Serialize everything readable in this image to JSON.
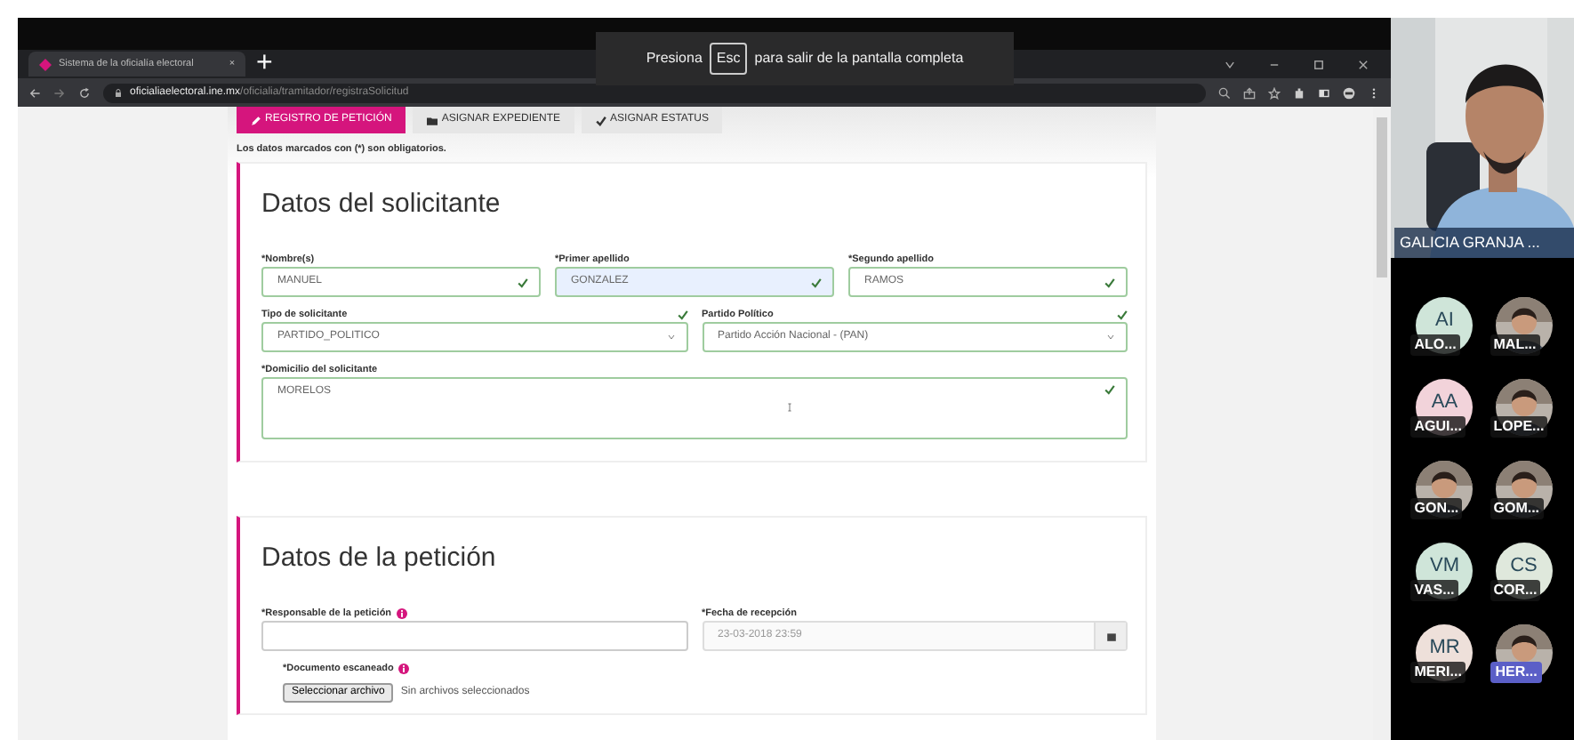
{
  "browser": {
    "tab": {
      "title": "Sistema de la oficialía electoral",
      "close": "×"
    },
    "new_tab": "+",
    "url": {
      "domain": "oficialiaelectoral.ine.mx",
      "path": "/oficialia/tramitador/registraSolicitud"
    }
  },
  "fullscreen_notice": {
    "prefix": "Presiona",
    "key": "Esc",
    "suffix": "para salir de la pantalla completa"
  },
  "tabs": [
    {
      "label": "REGISTRO DE PETICIÓN",
      "selected": true
    },
    {
      "label": "ASIGNAR EXPEDIENTE",
      "selected": false
    },
    {
      "label": "ASIGNAR ESTATUS",
      "selected": false
    }
  ],
  "required_note": "Los datos marcados con (*) son obligatorios.",
  "sections": [
    {
      "title": "Datos del solicitante",
      "rows": [
        [
          {
            "kind": "text",
            "label": "*Nombre(s)",
            "value": "MANUEL",
            "valid": true,
            "highlighted": false
          },
          {
            "kind": "text",
            "label": "*Primer apellido",
            "value": "GONZALEZ",
            "valid": true,
            "highlighted": true
          },
          {
            "kind": "text",
            "label": "*Segundo apellido",
            "value": "RAMOS",
            "valid": true,
            "highlighted": false
          }
        ],
        [
          {
            "kind": "select",
            "label": "Tipo de solicitante",
            "value": "PARTIDO_POLITICO",
            "valid": true,
            "highlighted": false
          },
          {
            "kind": "select",
            "label": "Partido Político",
            "value": "Partido Acción Nacional - (PAN)",
            "valid": true,
            "highlighted": false
          }
        ],
        [
          {
            "kind": "textarea",
            "label": "*Domicilio del solicitante",
            "value": "MORELOS",
            "valid": true,
            "highlighted": false
          }
        ]
      ]
    },
    {
      "title": "Datos de la petición",
      "rows": [
        [
          {
            "kind": "text",
            "label": "*Responsable de la petición",
            "info": true,
            "valid": false,
            "highlighted": false
          },
          {
            "kind": "date",
            "label": "*Fecha de recepción",
            "placeholder": "23-03-2018 23:59"
          }
        ],
        [
          {
            "kind": "file",
            "label": "*Documento escaneado",
            "info": true,
            "button": "Seleccionar archivo",
            "status": "Sin archivos seleccionados"
          }
        ]
      ]
    }
  ],
  "speaker": {
    "name": "GALICIA GRANJA ..."
  },
  "participants": [
    {
      "kind": "initials",
      "initials": "AI",
      "name": "ALO...",
      "color": "#cfe5d9",
      "highlighted": false
    },
    {
      "name": "MAL...",
      "highlighted": false
    },
    {
      "kind": "initials",
      "initials": "AA",
      "name": "AGUI...",
      "color": "#f2d3da",
      "highlighted": false
    },
    {
      "name": "LOPE...",
      "highlighted": false
    },
    {
      "name": "GON...",
      "highlighted": false
    },
    {
      "name": "GOM...",
      "highlighted": false
    },
    {
      "kind": "initials",
      "initials": "VM",
      "name": "VAS...",
      "color": "#cfe5d9",
      "highlighted": false
    },
    {
      "kind": "initials",
      "initials": "CS",
      "name": "COR...",
      "color": "#dfe8dc",
      "highlighted": false
    },
    {
      "kind": "initials",
      "initials": "MR",
      "name": "MERI...",
      "color": "#eee0da",
      "highlighted": false
    },
    {
      "name": "HER...",
      "highlighted": true
    }
  ]
}
